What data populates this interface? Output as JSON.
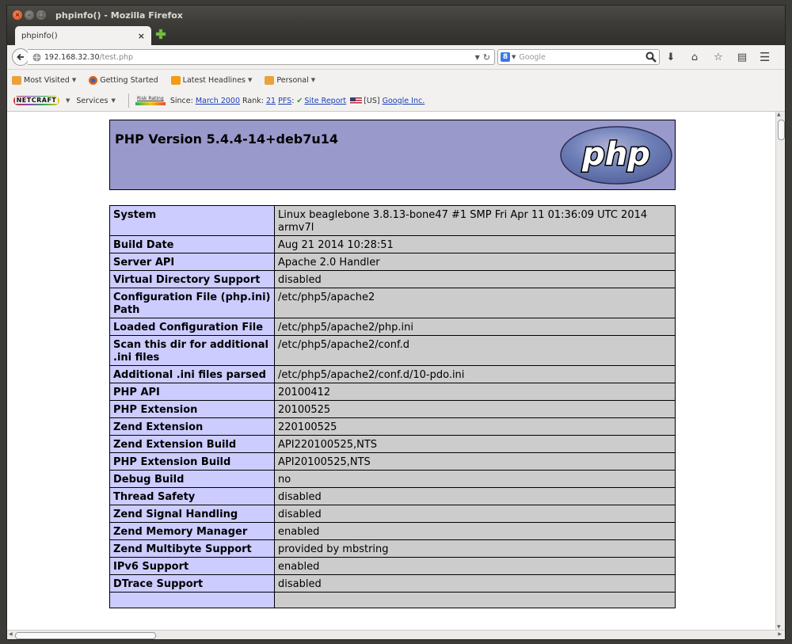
{
  "window": {
    "title": "phpinfo() - Mozilla Firefox",
    "button_close": "×",
    "button_min": "–",
    "button_max": "□"
  },
  "tab": {
    "label": "phpinfo()",
    "close": "×"
  },
  "navbar": {
    "url_host": "192.168.32.30",
    "url_path": "/test.php",
    "search_placeholder": "Google",
    "search_engine_icon": "8"
  },
  "bookmarks": [
    {
      "label": "Most Visited",
      "icon": "folder-icon",
      "color": "#e9a23b",
      "dropdown": true
    },
    {
      "label": "Getting Started",
      "icon": "firefox-icon",
      "color": "#e66000",
      "dropdown": false
    },
    {
      "label": "Latest Headlines",
      "icon": "rss-icon",
      "color": "#f39c12",
      "dropdown": true
    },
    {
      "label": "Personal",
      "icon": "folder-icon",
      "color": "#e9a23b",
      "dropdown": true
    }
  ],
  "netcraft": {
    "logo": "NETCRAFT",
    "services": "Services",
    "risk": "Risk Rating",
    "since_label": "Since:",
    "since_value": "March 2000",
    "rank_label": "Rank:",
    "rank_value": "21",
    "pfs_label": "PFS",
    "pfs_colon": ":",
    "site_report": "Site Report",
    "country": "[US]",
    "company": "Google Inc."
  },
  "php": {
    "version_title": "PHP Version 5.4.4-14+deb7u14",
    "logo_text": "php",
    "rows": [
      {
        "key": "System",
        "value": "Linux beaglebone 3.8.13-bone47 #1 SMP Fri Apr 11 01:36:09 UTC 2014 armv7l"
      },
      {
        "key": "Build Date",
        "value": "Aug 21 2014 10:28:51"
      },
      {
        "key": "Server API",
        "value": "Apache 2.0 Handler"
      },
      {
        "key": "Virtual Directory Support",
        "value": "disabled"
      },
      {
        "key": "Configuration File (php.ini) Path",
        "value": "/etc/php5/apache2"
      },
      {
        "key": "Loaded Configuration File",
        "value": "/etc/php5/apache2/php.ini"
      },
      {
        "key": "Scan this dir for additional .ini files",
        "value": "/etc/php5/apache2/conf.d"
      },
      {
        "key": "Additional .ini files parsed",
        "value": "/etc/php5/apache2/conf.d/10-pdo.ini"
      },
      {
        "key": "PHP API",
        "value": "20100412"
      },
      {
        "key": "PHP Extension",
        "value": "20100525"
      },
      {
        "key": "Zend Extension",
        "value": "220100525"
      },
      {
        "key": "Zend Extension Build",
        "value": "API220100525,NTS"
      },
      {
        "key": "PHP Extension Build",
        "value": "API20100525,NTS"
      },
      {
        "key": "Debug Build",
        "value": "no"
      },
      {
        "key": "Thread Safety",
        "value": "disabled"
      },
      {
        "key": "Zend Signal Handling",
        "value": "disabled"
      },
      {
        "key": "Zend Memory Manager",
        "value": "enabled"
      },
      {
        "key": "Zend Multibyte Support",
        "value": "provided by mbstring"
      },
      {
        "key": "IPv6 Support",
        "value": "enabled"
      },
      {
        "key": "DTrace Support",
        "value": "disabled"
      },
      {
        "key": "",
        "value": ""
      }
    ]
  },
  "colors": {
    "php_header": "#9999cc",
    "key_cell": "#ccccff",
    "value_cell": "#cccccc",
    "titlebar": "#3c3b37"
  }
}
